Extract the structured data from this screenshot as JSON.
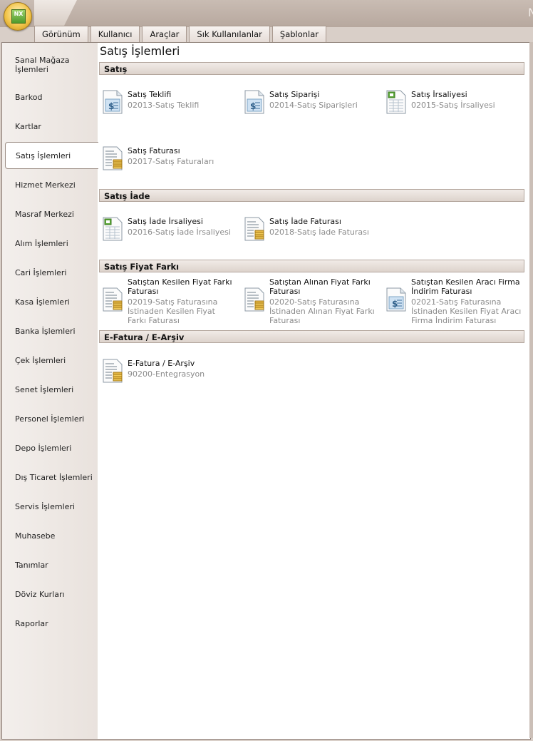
{
  "app": {
    "logo_text": "NX",
    "title_fragment": "N"
  },
  "tabs": [
    "Görünüm",
    "Kullanıcı",
    "Araçlar",
    "Sık Kullanılanlar",
    "Şablonlar"
  ],
  "sidebar": {
    "items": [
      "Sanal Mağaza İşlemleri",
      "Barkod",
      "Kartlar",
      "Satış İşlemleri",
      "Hizmet Merkezi",
      "Masraf Merkezi",
      "Alım İşlemleri",
      "Cari İşlemleri",
      "Kasa İşlemleri",
      "Banka İşlemleri",
      "Çek İşlemleri",
      "Senet İşlemleri",
      "Personel İşlemleri",
      "Depo İşlemleri",
      "Dış Ticaret İşlemleri",
      "Servis İşlemleri",
      "Muhasebe",
      "Tanımlar",
      "Döviz Kurları",
      "Raporlar"
    ],
    "active": "Satış İşlemleri"
  },
  "main": {
    "title": "Satış İşlemleri",
    "groups": [
      {
        "label": "Satış",
        "items": [
          {
            "label": "Satış Teklifi",
            "sub": "02013-Satış Teklifi",
            "icon": "document-dollar-icon"
          },
          {
            "label": "Satış Siparişi",
            "sub": "02014-Satış Siparişleri",
            "icon": "document-dollar-icon"
          },
          {
            "label": "Satış İrsaliyesi",
            "sub": "02015-Satış İrsaliyesi",
            "icon": "spreadsheet-icon"
          },
          {
            "label": "Satış Faturası",
            "sub": "02017-Satış Faturaları",
            "icon": "invoice-coins-icon"
          }
        ]
      },
      {
        "label": "Satış İade",
        "items": [
          {
            "label": "Satış İade İrsaliyesi",
            "sub": "02016-Satış İade İrsaliyesi",
            "icon": "spreadsheet-icon"
          },
          {
            "label": "Satış İade Faturası",
            "sub": "02018-Satış İade Faturası",
            "icon": "invoice-coins-icon"
          }
        ]
      },
      {
        "label": "Satış Fiyat Farkı",
        "items": [
          {
            "label": "Satıştan Kesilen Fiyat Farkı Faturası",
            "sub": "02019-Satış Faturasına İstinaden Kesilen Fiyat Farkı Faturası",
            "icon": "invoice-coins-icon"
          },
          {
            "label": "Satıştan Alınan Fiyat Farkı Faturası",
            "sub": "02020-Satış Faturasına İstinaden Alınan Fiyat Farkı Faturası",
            "icon": "invoice-coins-icon"
          },
          {
            "label": "Satıştan Kesilen Aracı Firma İndirim Faturası",
            "sub": "02021-Satış Faturasına İstinaden Kesilen Fiyat Aracı Firma İndirim  Faturası",
            "icon": "document-dollar-icon"
          }
        ]
      },
      {
        "label": "E-Fatura / E-Arşiv",
        "items": [
          {
            "label": "E-Fatura / E-Arşiv",
            "sub": "90200-Entegrasyon",
            "icon": "invoice-coins-icon"
          }
        ]
      }
    ]
  }
}
